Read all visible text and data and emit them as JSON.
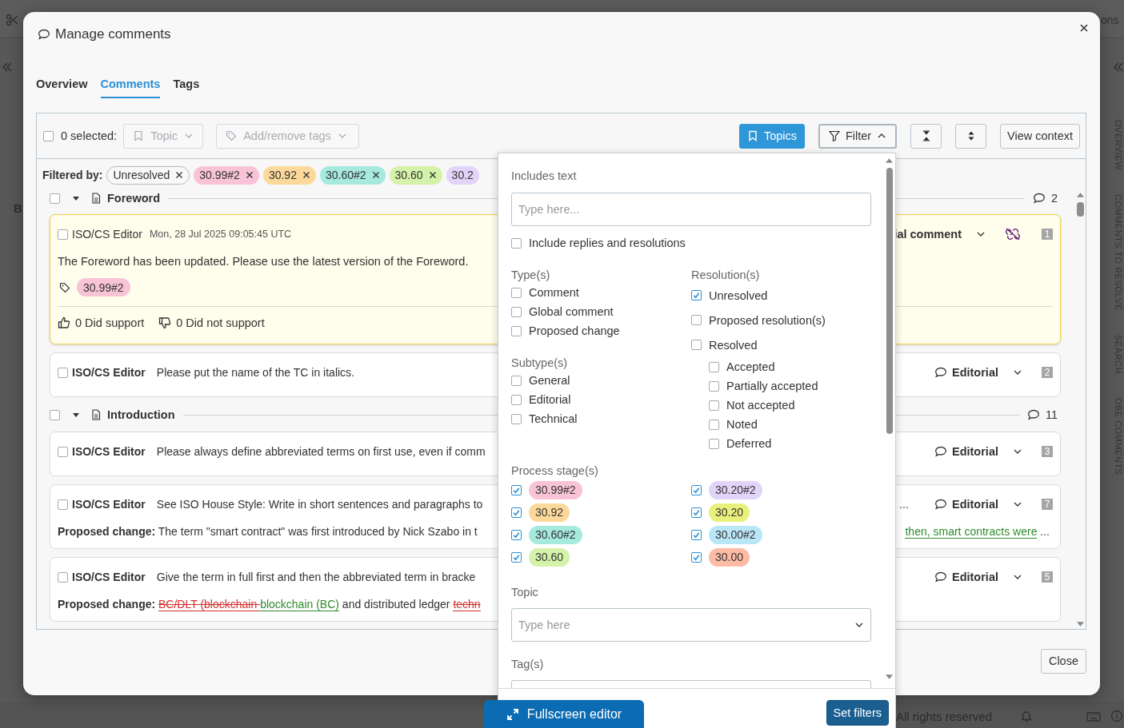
{
  "background": {
    "corner_text": "ons",
    "side_letter": "B",
    "side_tabs": [
      "OVERVIEW",
      "COMMENTS TO RESOLVE",
      "SEARCH",
      "OBE COMMENTS"
    ],
    "footer_text": "All rights reserved",
    "editor_button": "Fullscreen editor"
  },
  "dialog": {
    "title": "Manage comments",
    "close_button": "Close"
  },
  "tabs": [
    {
      "label": "Overview",
      "selected": false
    },
    {
      "label": "Comments",
      "selected": true
    },
    {
      "label": "Tags",
      "selected": false
    }
  ],
  "toolbar": {
    "select_all": false,
    "selected_count": "0 selected:",
    "topic_dropdown": "Topic",
    "tags_dropdown": "Add/remove tags",
    "topics_button": "Topics",
    "filter_button": "Filter",
    "filter_open": true,
    "view_context_button": "View context"
  },
  "filtered_by": {
    "label": "Filtered by:",
    "chips": [
      {
        "kind": "status",
        "label": "Unresolved",
        "removable": true
      },
      {
        "kind": "stage",
        "label": "30.99#2",
        "color": "#f8c3d6",
        "removable": true
      },
      {
        "kind": "stage",
        "label": "30.92",
        "color": "#fcd99b",
        "removable": true
      },
      {
        "kind": "stage",
        "label": "30.60#2",
        "color": "#a6e9df",
        "removable": true
      },
      {
        "kind": "stage",
        "label": "30.60",
        "color": "#d5f2aa",
        "removable": true
      },
      {
        "kind": "stage",
        "label": "30.2",
        "color": "#e2d3f8",
        "removable": false
      }
    ]
  },
  "groups": [
    {
      "title": "Foreword",
      "checked": false,
      "expanded": true,
      "count": "2",
      "comments": [
        {
          "kind": "expanded",
          "checked": false,
          "highlighted": true,
          "author": "ISO/CS Editor",
          "date": "Mon, 28 Jul 2025 09:05:45 UTC",
          "text": "The Foreword has been updated. Please use the latest version of the Foreword.",
          "type": "ial comment",
          "unlinked": true,
          "number": "1",
          "tags": [
            {
              "label": "30.99#2",
              "color": "#f8c3d6"
            }
          ],
          "support": "0 Did support",
          "no_support": "0 Did not support"
        },
        {
          "kind": "compact",
          "checked": false,
          "highlighted": false,
          "author": "ISO/CS Editor",
          "text": "Please put the name of the TC in italics.",
          "type": "Editorial",
          "number": "2"
        }
      ]
    },
    {
      "title": "Introduction",
      "checked": false,
      "expanded": true,
      "count": "11",
      "comments": [
        {
          "kind": "compact",
          "checked": false,
          "highlighted": false,
          "author": "ISO/CS Editor",
          "text": "Please always define abbreviated terms on first use, even if comm",
          "type": "Editorial",
          "number": "3"
        },
        {
          "kind": "compact",
          "checked": false,
          "highlighted": false,
          "author": "ISO/CS Editor",
          "text": "See ISO House Style: Write in short sentences and paragraphs to",
          "text_tail": "...",
          "type": "Editorial",
          "number": "7",
          "proposed": {
            "label": "Proposed change:",
            "segments": [
              {
                "kind": "plain",
                "text": "The term \"smart contract\" was first introduced by Nick Szabo in t"
              }
            ],
            "tail": [
              {
                "kind": "inserted",
                "text": "then, smart contracts were"
              },
              {
                "kind": "plain",
                "text": " ..."
              }
            ]
          }
        },
        {
          "kind": "compact",
          "checked": false,
          "highlighted": false,
          "author": "ISO/CS Editor",
          "text": "Give the term in full first and then the abbreviated term in bracke",
          "type": "Editorial",
          "number": "5",
          "proposed": {
            "label": "Proposed change:",
            "segments": [
              {
                "kind": "deleted",
                "text": "BC/DLT (blockchain "
              },
              {
                "kind": "inserted",
                "text": "blockchain (BC)"
              },
              {
                "kind": "plain",
                "text": " and distributed ledger "
              },
              {
                "kind": "deleted",
                "text": "techn"
              }
            ]
          }
        }
      ]
    }
  ],
  "filter_panel": {
    "includes_label": "Includes text",
    "includes_placeholder": "Type here...",
    "include_replies": {
      "label": "Include replies and resolutions",
      "checked": false
    },
    "types": {
      "heading": "Type(s)",
      "options": [
        {
          "label": "Comment",
          "checked": false
        },
        {
          "label": "Global comment",
          "checked": false
        },
        {
          "label": "Proposed change",
          "checked": false
        }
      ]
    },
    "subtypes": {
      "heading": "Subtype(s)",
      "options": [
        {
          "label": "General",
          "checked": false
        },
        {
          "label": "Editorial",
          "checked": false
        },
        {
          "label": "Technical",
          "checked": false
        }
      ]
    },
    "resolutions": {
      "heading": "Resolution(s)",
      "options": [
        {
          "label": "Unresolved",
          "checked": true
        },
        {
          "label": "Proposed resolution(s)",
          "checked": false
        },
        {
          "label": "Resolved",
          "checked": false,
          "children": [
            {
              "label": "Accepted",
              "checked": false
            },
            {
              "label": "Partially accepted",
              "checked": false
            },
            {
              "label": "Not accepted",
              "checked": false
            },
            {
              "label": "Noted",
              "checked": false
            },
            {
              "label": "Deferred",
              "checked": false
            }
          ]
        }
      ]
    },
    "stages": {
      "heading": "Process stage(s)",
      "options": [
        {
          "label": "30.99#2",
          "checked": true,
          "color": "#f8c3d6"
        },
        {
          "label": "30.20#2",
          "checked": true,
          "color": "#e2d3f8"
        },
        {
          "label": "30.92",
          "checked": true,
          "color": "#fcd99b"
        },
        {
          "label": "30.20",
          "checked": true,
          "color": "#e9f07c"
        },
        {
          "label": "30.60#2",
          "checked": true,
          "color": "#a6e9df"
        },
        {
          "label": "30.00#2",
          "checked": true,
          "color": "#bae7f8"
        },
        {
          "label": "30.60",
          "checked": true,
          "color": "#d5f2aa"
        },
        {
          "label": "30.00",
          "checked": true,
          "color": "#fdbba6"
        }
      ]
    },
    "topic_label": "Topic",
    "topic_placeholder": "Type here",
    "tags_label": "Tag(s)",
    "set_filters_button": "Set filters"
  }
}
